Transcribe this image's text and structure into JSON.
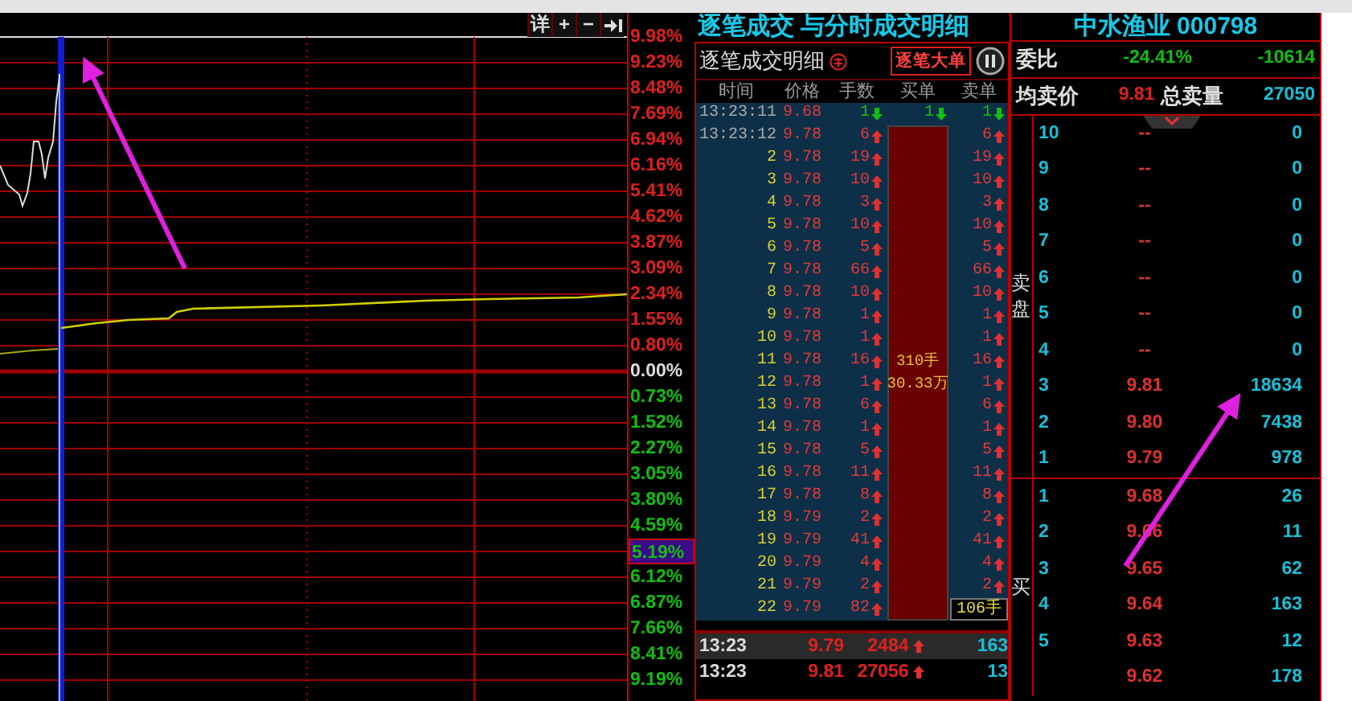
{
  "chart": {
    "toolbar": [
      {
        "kind": "text",
        "label": "详"
      },
      {
        "kind": "text",
        "label": "+"
      },
      {
        "kind": "text",
        "label": "−"
      },
      {
        "kind": "icon"
      }
    ],
    "axis_labels": [
      {
        "text": "9.98%",
        "kind": "up"
      },
      {
        "text": "9.23%",
        "kind": "up"
      },
      {
        "text": "8.48%",
        "kind": "up"
      },
      {
        "text": "7.69%",
        "kind": "up"
      },
      {
        "text": "6.94%",
        "kind": "up"
      },
      {
        "text": "6.16%",
        "kind": "up"
      },
      {
        "text": "5.41%",
        "kind": "up"
      },
      {
        "text": "4.62%",
        "kind": "up"
      },
      {
        "text": "3.87%",
        "kind": "up"
      },
      {
        "text": "3.09%",
        "kind": "up"
      },
      {
        "text": "2.34%",
        "kind": "up"
      },
      {
        "text": "1.55%",
        "kind": "up"
      },
      {
        "text": "0.80%",
        "kind": "up"
      },
      {
        "text": "0.00%",
        "kind": "flat"
      },
      {
        "text": "0.73%",
        "kind": "down"
      },
      {
        "text": "1.52%",
        "kind": "down"
      },
      {
        "text": "2.27%",
        "kind": "down"
      },
      {
        "text": "3.05%",
        "kind": "down"
      },
      {
        "text": "3.80%",
        "kind": "down"
      },
      {
        "text": "4.59%",
        "kind": "down"
      },
      {
        "text": "5.19%",
        "kind": "cursor"
      },
      {
        "text": "6.12%",
        "kind": "down"
      },
      {
        "text": "6.87%",
        "kind": "down"
      },
      {
        "text": "7.66%",
        "kind": "down"
      },
      {
        "text": "8.41%",
        "kind": "down"
      },
      {
        "text": "9.19%",
        "kind": "down"
      }
    ]
  },
  "ticks": {
    "title": "逐笔成交 与分时成交明细",
    "panel_title": "逐笔成交明细",
    "big_order_button": "逐笔大单",
    "columns": [
      "时间",
      "价格",
      "手数",
      "买单",
      "卖单"
    ],
    "rows": [
      {
        "time": "13:23:11",
        "kind": "full",
        "price": "9.68",
        "volume": "1",
        "rising": false,
        "buy": "1",
        "sell": "1"
      },
      {
        "time": "13:23:12",
        "kind": "full",
        "price": "9.78",
        "volume": "6",
        "rising": true,
        "sell": "6"
      },
      {
        "time": "2",
        "kind": "seq",
        "price": "9.78",
        "volume": "19",
        "rising": true,
        "sell": "19"
      },
      {
        "time": "3",
        "kind": "seq",
        "price": "9.78",
        "volume": "10",
        "rising": true,
        "sell": "10"
      },
      {
        "time": "4",
        "kind": "seq",
        "price": "9.78",
        "volume": "3",
        "rising": true,
        "sell": "3"
      },
      {
        "time": "5",
        "kind": "seq",
        "price": "9.78",
        "volume": "10",
        "rising": true,
        "sell": "10"
      },
      {
        "time": "6",
        "kind": "seq",
        "price": "9.78",
        "volume": "5",
        "rising": true,
        "sell": "5"
      },
      {
        "time": "7",
        "kind": "seq",
        "price": "9.78",
        "volume": "66",
        "rising": true,
        "sell": "66"
      },
      {
        "time": "8",
        "kind": "seq",
        "price": "9.78",
        "volume": "10",
        "rising": true,
        "sell": "10"
      },
      {
        "time": "9",
        "kind": "seq",
        "price": "9.78",
        "volume": "1",
        "rising": true,
        "sell": "1"
      },
      {
        "time": "10",
        "kind": "seq",
        "price": "9.78",
        "volume": "1",
        "rising": true,
        "sell": "1"
      },
      {
        "time": "11",
        "kind": "seq",
        "price": "9.78",
        "volume": "16",
        "rising": true,
        "sell": "16"
      },
      {
        "time": "12",
        "kind": "seq",
        "price": "9.78",
        "volume": "1",
        "rising": true,
        "sell": "1"
      },
      {
        "time": "13",
        "kind": "seq",
        "price": "9.78",
        "volume": "6",
        "rising": true,
        "sell": "6"
      },
      {
        "time": "14",
        "kind": "seq",
        "price": "9.78",
        "volume": "1",
        "rising": true,
        "sell": "1"
      },
      {
        "time": "15",
        "kind": "seq",
        "price": "9.78",
        "volume": "5",
        "rising": true,
        "sell": "5"
      },
      {
        "time": "16",
        "kind": "seq",
        "price": "9.78",
        "volume": "11",
        "rising": true,
        "sell": "11"
      },
      {
        "time": "17",
        "kind": "seq",
        "price": "9.78",
        "volume": "8",
        "rising": true,
        "sell": "8"
      },
      {
        "time": "18",
        "kind": "seq",
        "price": "9.79",
        "volume": "2",
        "rising": true,
        "sell": "2"
      },
      {
        "time": "19",
        "kind": "seq",
        "price": "9.79",
        "volume": "41",
        "rising": true,
        "sell": "41"
      },
      {
        "time": "20",
        "kind": "seq",
        "price": "9.79",
        "volume": "4",
        "rising": true,
        "sell": "4"
      },
      {
        "time": "21",
        "kind": "seq",
        "price": "9.79",
        "volume": "2",
        "rising": true,
        "sell": "2"
      },
      {
        "time": "22",
        "kind": "seq",
        "price": "9.79",
        "volume": "82",
        "rising": true
      }
    ],
    "buy_block": {
      "volume": "310手",
      "amount": "30.33万"
    },
    "sell_total": "106手",
    "minute_rows": [
      {
        "time": "13:23",
        "price": "9.79",
        "volume": "2484",
        "rising": true,
        "count": "163",
        "selected": true
      },
      {
        "time": "13:23",
        "price": "9.81",
        "volume": "27056",
        "rising": true,
        "count": "13",
        "selected": false
      }
    ]
  },
  "quote": {
    "title": "中水渔业 000798",
    "ratio_label": "委比",
    "ratio": "-24.41%",
    "diff": "-10614",
    "avg_label": "均卖价",
    "avg_price": "9.81",
    "total_label": "总卖量",
    "total": "27050",
    "sell_side": "卖盘",
    "sells": [
      {
        "level": "10",
        "price": "--",
        "volume": "0"
      },
      {
        "level": "9",
        "price": "--",
        "volume": "0"
      },
      {
        "level": "8",
        "price": "--",
        "volume": "0"
      },
      {
        "level": "7",
        "price": "--",
        "volume": "0"
      },
      {
        "level": "6",
        "price": "--",
        "volume": "0"
      },
      {
        "level": "5",
        "price": "--",
        "volume": "0"
      },
      {
        "level": "4",
        "price": "--",
        "volume": "0"
      },
      {
        "level": "3",
        "price": "9.81",
        "volume": "18634"
      },
      {
        "level": "2",
        "price": "9.80",
        "volume": "7438"
      },
      {
        "level": "1",
        "price": "9.79",
        "volume": "978"
      }
    ],
    "buy_side": "买",
    "buys": [
      {
        "level": "1",
        "price": "9.68",
        "volume": "26"
      },
      {
        "level": "2",
        "price": "9.66",
        "volume": "11"
      },
      {
        "level": "3",
        "price": "9.65",
        "volume": "62"
      },
      {
        "level": "4",
        "price": "9.64",
        "volume": "163"
      },
      {
        "level": "5",
        "price": "9.63",
        "volume": "12"
      },
      {
        "price": "9.62",
        "volume": "178"
      }
    ]
  }
}
